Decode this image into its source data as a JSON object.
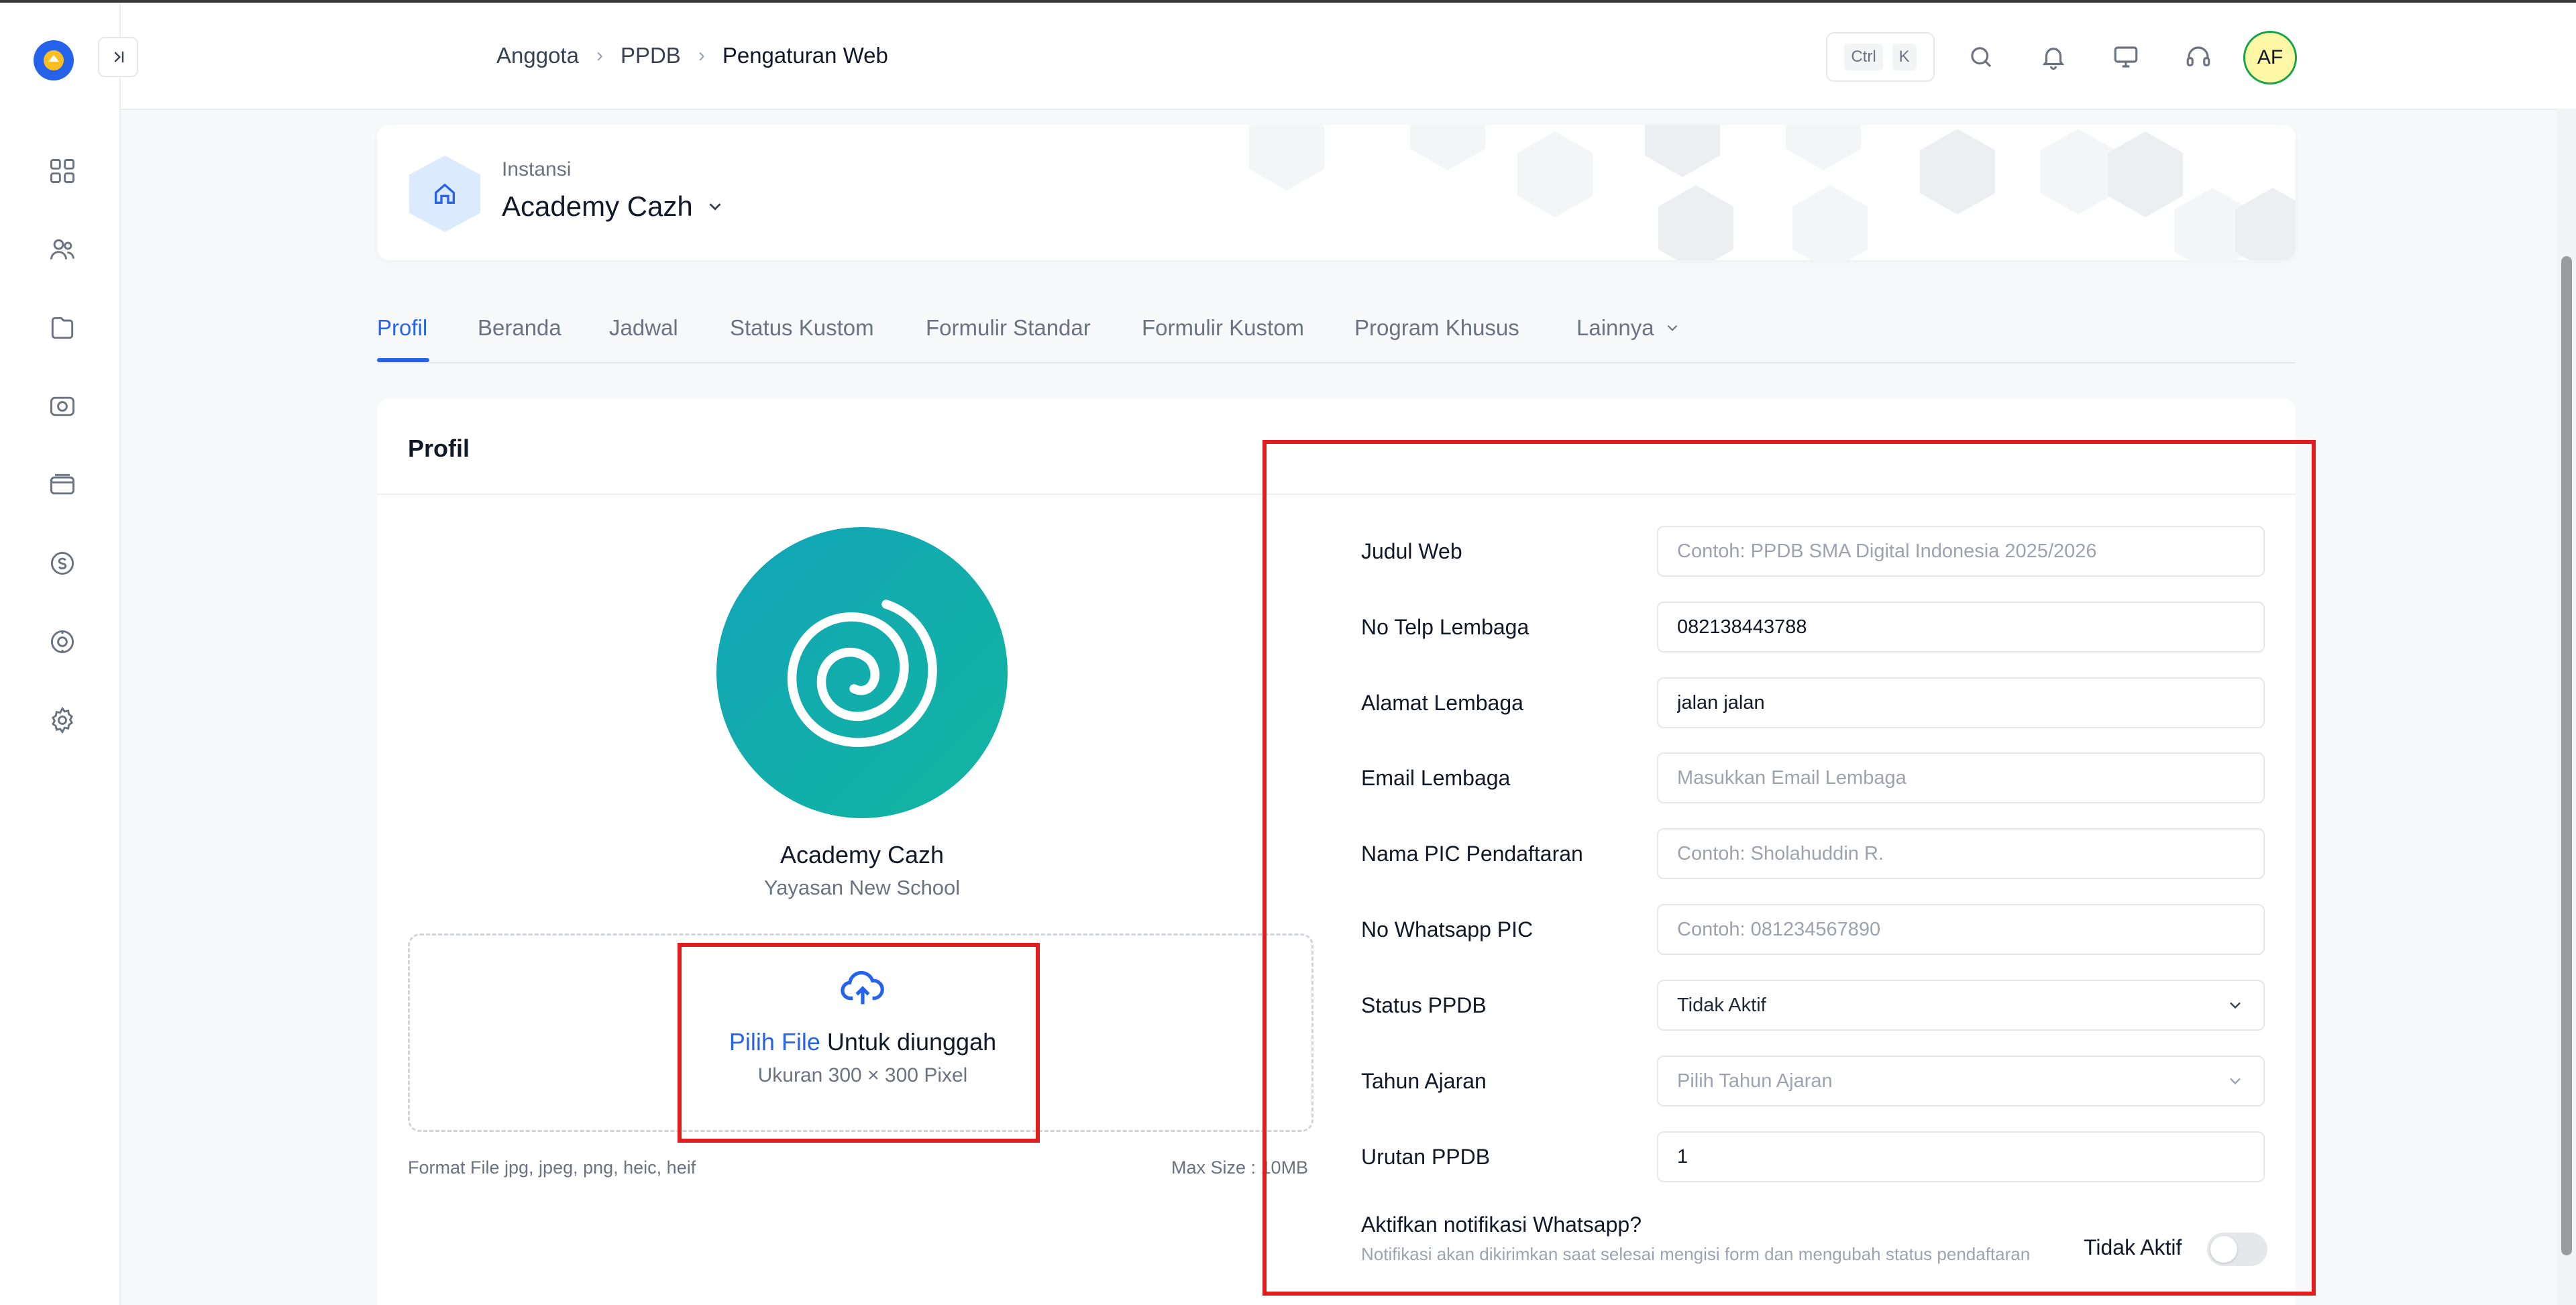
{
  "header": {
    "breadcrumb": [
      "Anggota",
      "PPDB",
      "Pengaturan Web"
    ],
    "kbd_ctrl": "Ctrl",
    "kbd_k": "K",
    "avatar_initials": "AF"
  },
  "sidebar": {
    "icons": [
      "dashboard-icon",
      "users-icon",
      "folder-icon",
      "camera-icon",
      "card-icon",
      "wallet-icon",
      "badge-icon",
      "gear-icon"
    ]
  },
  "instansi": {
    "label": "Instansi",
    "name": "Academy Cazh"
  },
  "tabs": [
    {
      "label": "Profil",
      "active": true
    },
    {
      "label": "Beranda"
    },
    {
      "label": "Jadwal"
    },
    {
      "label": "Status Kustom"
    },
    {
      "label": "Formulir Standar"
    },
    {
      "label": "Formulir Kustom"
    },
    {
      "label": "Program Khusus"
    },
    {
      "label": "Lainnya"
    }
  ],
  "profile": {
    "card_title": "Profil",
    "name": "Academy Cazh",
    "subtitle": "Yayasan New School",
    "upload_link": "Pilih File",
    "upload_text": "Untuk diunggah",
    "upload_size": "Ukuran 300 × 300 Pixel",
    "format_hint": "Format File jpg, jpeg, png, heic, heif",
    "max_size": "Max Size : 10MB"
  },
  "form": {
    "judul_web": {
      "label": "Judul Web",
      "value": "",
      "placeholder": "Contoh: PPDB SMA Digital Indonesia 2025/2026"
    },
    "no_telp": {
      "label": "No Telp Lembaga",
      "value": "082138443788",
      "placeholder": ""
    },
    "alamat": {
      "label": "Alamat Lembaga",
      "value": "jalan jalan",
      "placeholder": ""
    },
    "email": {
      "label": "Email Lembaga",
      "value": "",
      "placeholder": "Masukkan Email Lembaga"
    },
    "nama_pic": {
      "label": "Nama PIC Pendaftaran",
      "value": "",
      "placeholder": "Contoh: Sholahuddin R."
    },
    "no_wa_pic": {
      "label": "No Whatsapp PIC",
      "value": "",
      "placeholder": "Contoh: 081234567890"
    },
    "status_ppdb": {
      "label": "Status PPDB",
      "selected": "Tidak Aktif"
    },
    "tahun_ajaran": {
      "label": "Tahun Ajaran",
      "placeholder": "Pilih Tahun Ajaran"
    },
    "urutan": {
      "label": "Urutan PPDB",
      "value": "1",
      "placeholder": ""
    },
    "notif": {
      "title": "Aktifkan notifikasi Whatsapp?",
      "description": "Notifikasi akan dikirimkan saat selesai mengisi form dan mengubah status pendaftaran",
      "toggle_label": "Tidak Aktif",
      "enabled": false
    }
  },
  "colors": {
    "accent": "#2563eb",
    "highlight": "#e11d1d",
    "logo_gradient_start": "#12a4b8",
    "logo_gradient_end": "#12b5a0"
  }
}
